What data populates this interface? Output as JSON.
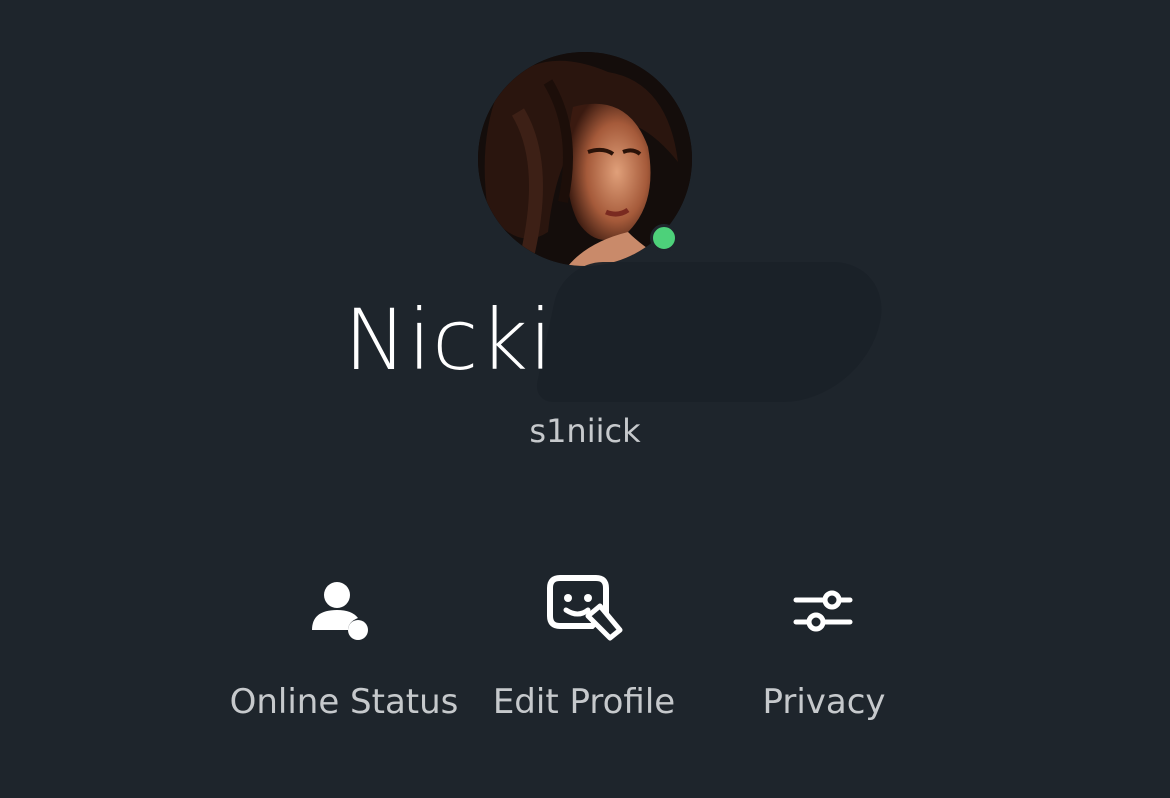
{
  "profile": {
    "display_name": "Nicki",
    "username": "s1niick",
    "status": "online",
    "status_color": "#4dd17a"
  },
  "actions": [
    {
      "label": "Online Status",
      "icon": "person-status-icon"
    },
    {
      "label": "Edit Profile",
      "icon": "edit-profile-icon"
    },
    {
      "label": "Privacy",
      "icon": "sliders-icon"
    }
  ],
  "colors": {
    "background": "#1e252c",
    "text_primary": "#ffffff",
    "text_secondary": "#c6c9cc"
  }
}
